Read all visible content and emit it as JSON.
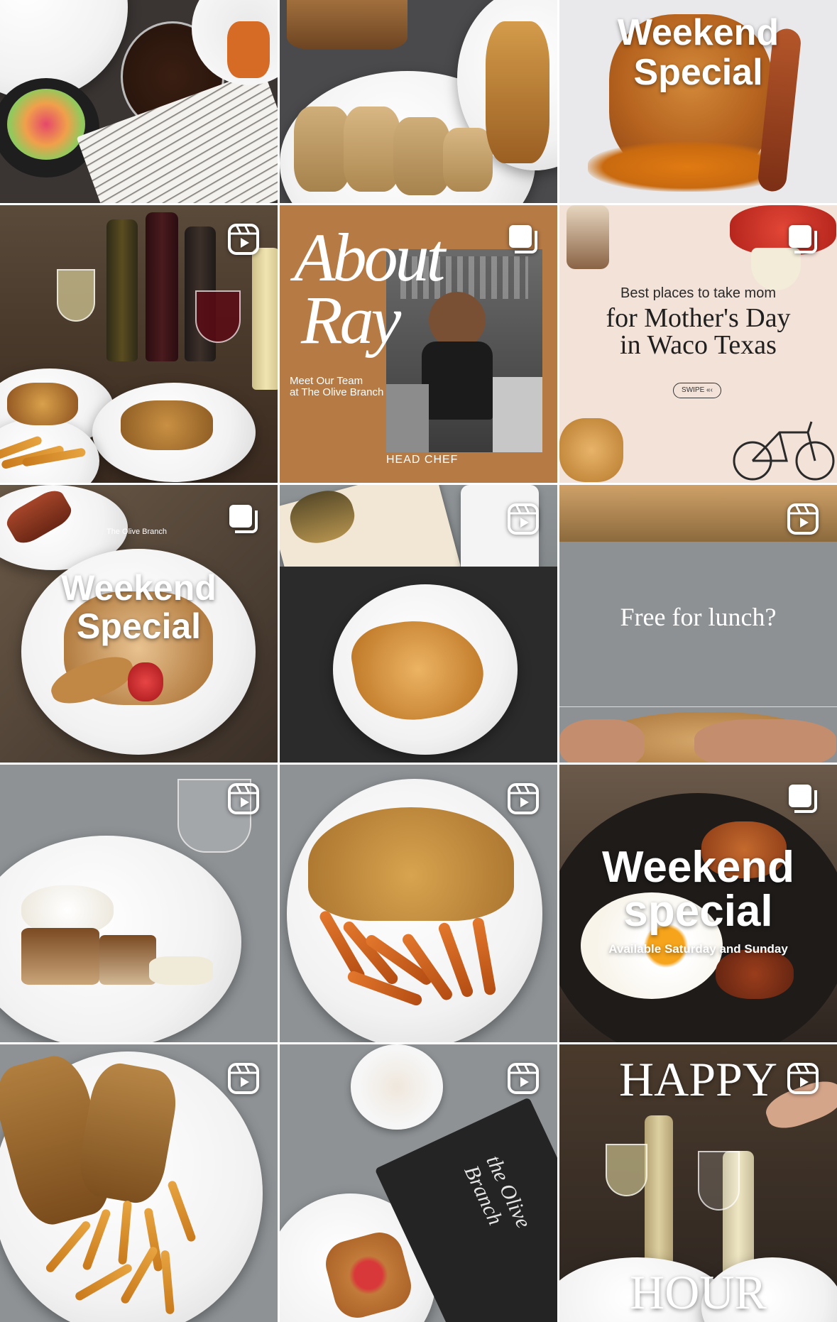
{
  "tiles": [
    {
      "id": "breakfast-table",
      "badge": "none"
    },
    {
      "id": "sandwiches",
      "badge": "none"
    },
    {
      "id": "weekend-special-waffle",
      "badge": "none",
      "caption": [
        "Weekend",
        "Special"
      ]
    },
    {
      "id": "wine-and-plates",
      "badge": "reel-icon"
    },
    {
      "id": "about-ray",
      "badge": "carousel-icon",
      "title_line1": "About",
      "title_line2": "Ray",
      "subtitle_line1": "Meet Our Team",
      "subtitle_line2": "at The Olive Branch",
      "footer": "HEAD CHEF"
    },
    {
      "id": "mothers-day",
      "badge": "carousel-icon",
      "kicker": "Best places to take mom",
      "title_line1": "for Mother's Day",
      "title_line2": "in Waco Texas",
      "pill": "SWIPE"
    },
    {
      "id": "weekend-special-french-toast",
      "badge": "carousel-icon",
      "watermark": "The Olive Branch",
      "caption": [
        "Weekend",
        "Special"
      ]
    },
    {
      "id": "croissant-journal",
      "badge": "reel-icon"
    },
    {
      "id": "free-for-lunch",
      "badge": "reel-icon",
      "caption": "Free for lunch?"
    },
    {
      "id": "cake-slice",
      "badge": "reel-icon"
    },
    {
      "id": "sandwich-sweet-fries",
      "badge": "reel-icon"
    },
    {
      "id": "weekend-special-skillet",
      "badge": "carousel-icon",
      "caption": [
        "Weekend",
        "special"
      ],
      "subcaption": "Available Saturday and Sunday"
    },
    {
      "id": "grilled-sandwich-fries",
      "badge": "reel-icon"
    },
    {
      "id": "coffee-menu",
      "badge": "reel-icon",
      "menu_text": "the Olive Branch"
    },
    {
      "id": "happy-hour",
      "badge": "reel-icon",
      "caption_top": "HAPPY",
      "caption_bottom": "HOUR"
    }
  ],
  "colors": {
    "about_bg": "#b67a45",
    "mothers_bg": "#f3e2d8",
    "slate": "#8d9194",
    "badge": "#ffffff"
  }
}
